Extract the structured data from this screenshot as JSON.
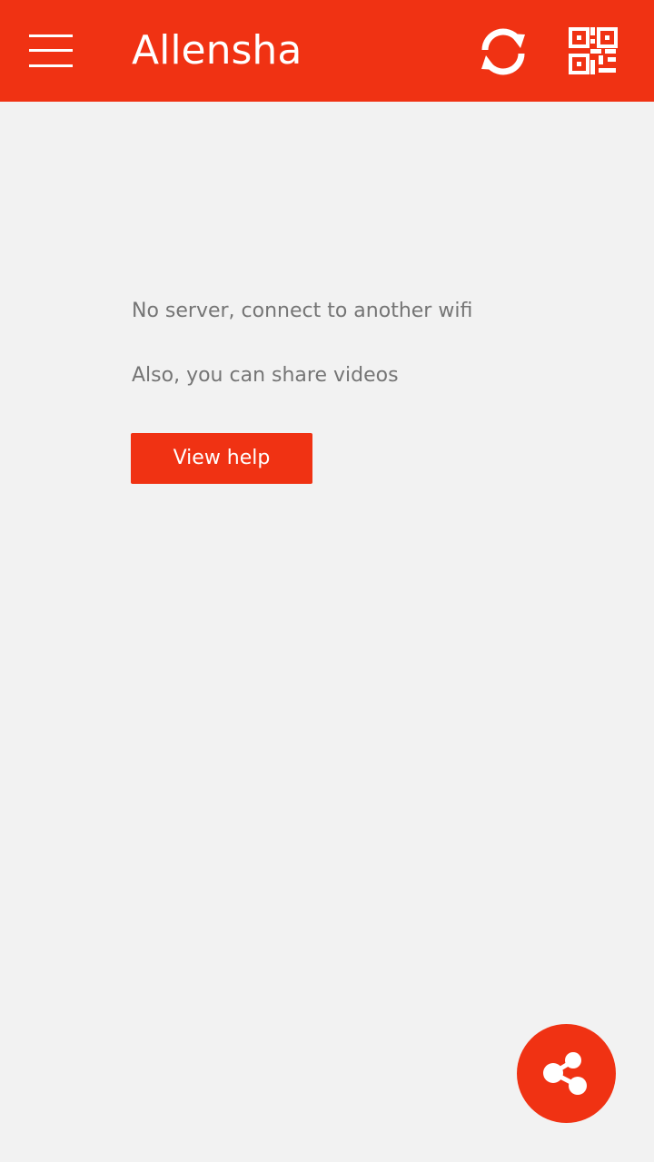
{
  "app_bar": {
    "title": "Allensha",
    "background": "#f03213",
    "icons": {
      "menu": "menu-icon",
      "sync": "sync-icon",
      "qr": "qr-code-icon"
    }
  },
  "main": {
    "empty_message": "No server, connect to another wifi",
    "share_hint": "Also, you can share videos",
    "help_button_label": "View help"
  },
  "fab": {
    "icon": "share-icon"
  },
  "colors": {
    "accent": "#f03213",
    "background": "#f2f2f2",
    "text_secondary": "#757575"
  }
}
